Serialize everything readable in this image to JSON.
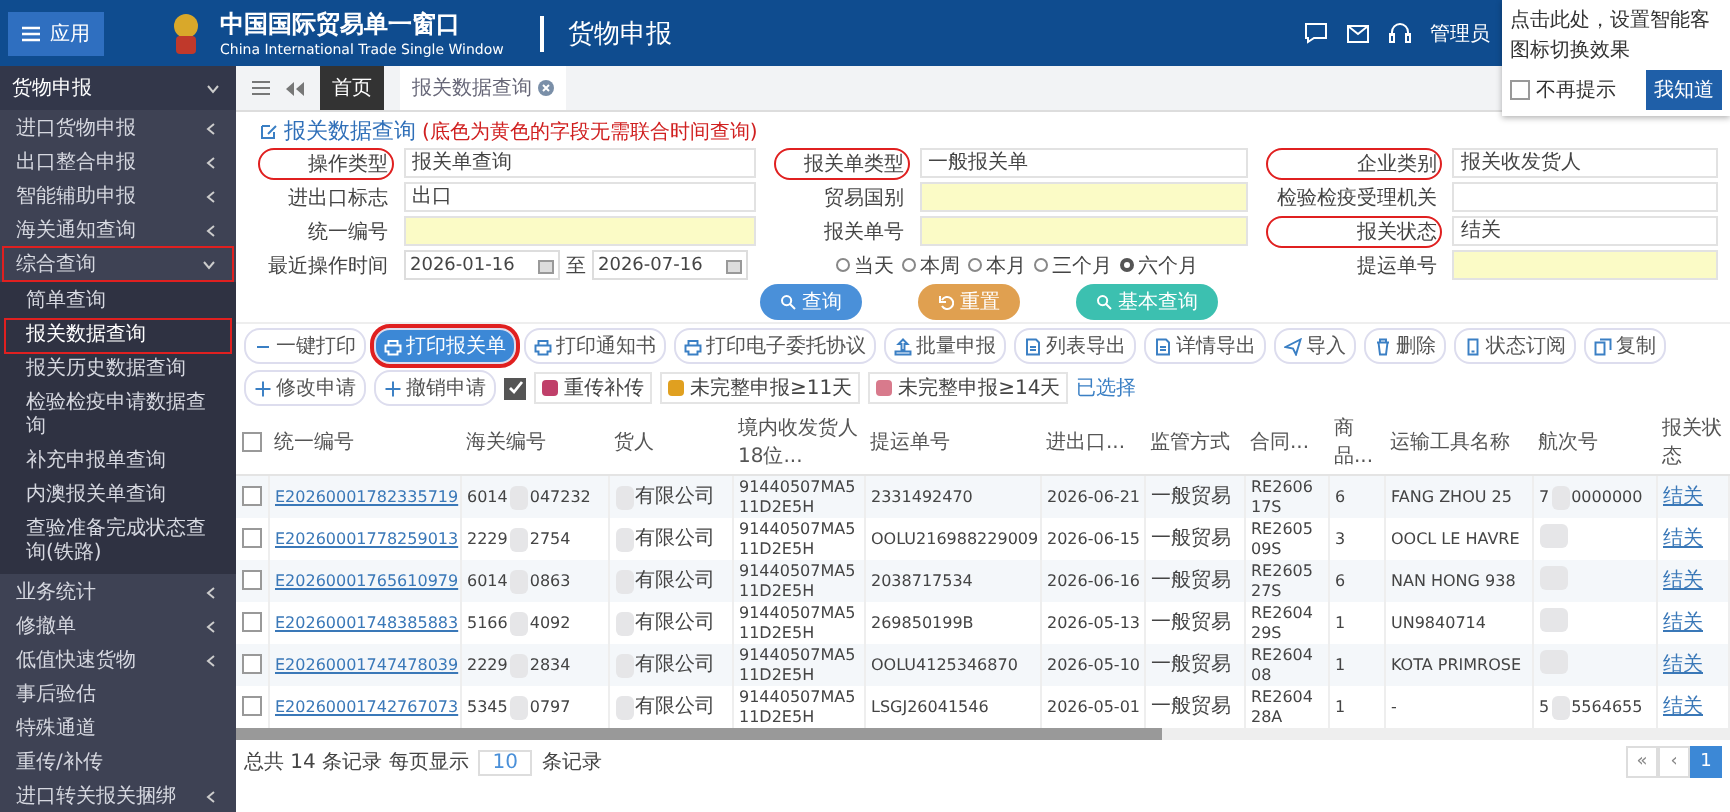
{
  "header": {
    "app_button": "应用",
    "logo_title": "中国国际贸易单一窗口",
    "logo_subtitle": "China International Trade Single Window",
    "module": "货物申报",
    "user": "管理员"
  },
  "tip": {
    "text": "点击此处，设置智能客",
    "text2": "图标切换效果",
    "dont_show": "不再提示",
    "dont_show_checked": false,
    "button": "我知道"
  },
  "sidebar": {
    "section": "货物申报",
    "items": [
      {
        "label": "进口货物申报",
        "expanded": false,
        "annotated": false
      },
      {
        "label": "出口整合申报",
        "expanded": false,
        "annotated": false
      },
      {
        "label": "智能辅助申报",
        "expanded": false,
        "annotated": false
      },
      {
        "label": "海关通知查询",
        "expanded": false,
        "annotated": false
      },
      {
        "label": "综合查询",
        "expanded": true,
        "annotated": true,
        "children": [
          {
            "label": "简单查询",
            "selected": false,
            "annotated": false
          },
          {
            "label": "报关数据查询",
            "selected": true,
            "annotated": true
          },
          {
            "label": "报关历史数据查询",
            "selected": false,
            "annotated": false
          },
          {
            "label": "检验检疫申请数据查询",
            "selected": false,
            "annotated": false
          },
          {
            "label": "补充申报单查询",
            "selected": false,
            "annotated": false
          },
          {
            "label": "内澳报关单查询",
            "selected": false,
            "annotated": false
          },
          {
            "label": "查验准备完成状态查询(铁路)",
            "selected": false,
            "annotated": false
          }
        ]
      },
      {
        "label": "业务统计",
        "expanded": false,
        "annotated": false
      },
      {
        "label": "修撤单",
        "expanded": false,
        "annotated": false
      },
      {
        "label": "低值快速货物",
        "expanded": false,
        "annotated": false
      },
      {
        "label": "事后验估",
        "annotated": false
      },
      {
        "label": "特殊通道",
        "annotated": false
      },
      {
        "label": "重传/补传",
        "annotated": false
      },
      {
        "label": "进口转关报关捆绑",
        "expanded": false,
        "annotated": false
      }
    ]
  },
  "tabs": [
    {
      "label": "首页",
      "selected": false,
      "closable": false
    },
    {
      "label": "报关数据查询",
      "selected": true,
      "closable": true
    }
  ],
  "form": {
    "title": "报关数据查询",
    "hint": "(底色为黄色的字段无需联合时间查询)",
    "cells": [
      {
        "kind": "text",
        "label": "操作类型",
        "value": "报关单查询",
        "required": false,
        "annotated": true
      },
      {
        "kind": "text",
        "label": "报关单类型",
        "value": "一般报关单",
        "required": false,
        "annotated": true
      },
      {
        "kind": "text",
        "label": "企业类别",
        "value": "报关收发货人",
        "required": false,
        "annotated": true
      },
      {
        "kind": "text",
        "label": "进出口标志",
        "value": "出口",
        "required": false,
        "annotated": false
      },
      {
        "kind": "text",
        "label": "贸易国别",
        "required": true,
        "annotated": false
      },
      {
        "kind": "text",
        "label": "检验检疫受理机关",
        "required": false,
        "annotated": false
      },
      {
        "kind": "text",
        "label": "统一编号",
        "required": true,
        "annotated": false
      },
      {
        "kind": "text",
        "label": "报关单号",
        "required": true,
        "annotated": false
      },
      {
        "kind": "text",
        "label": "报关状态",
        "value": "结关",
        "required": false,
        "annotated": true
      },
      {
        "kind": "date_range",
        "label": "最近操作时间",
        "from": "2026-01-16",
        "to_label": "至",
        "to": "2026-07-16"
      },
      {
        "kind": "radios",
        "options": [
          {
            "label": "当天",
            "selected": false
          },
          {
            "label": "本周",
            "selected": false
          },
          {
            "label": "本月",
            "selected": false
          },
          {
            "label": "三个月",
            "selected": false
          },
          {
            "label": "六个月",
            "selected": true
          }
        ]
      },
      {
        "kind": "text",
        "label": "提运单号",
        "required": true,
        "annotated": false
      }
    ],
    "buttons": [
      {
        "label": "查询",
        "kind": "search"
      },
      {
        "label": "重置",
        "kind": "reset"
      },
      {
        "label": "基本查询",
        "kind": "basic"
      }
    ]
  },
  "toolbar": {
    "buttons": [
      {
        "label": "一键打印",
        "kind": "minus",
        "selected": false,
        "annotated": false
      },
      {
        "label": "打印报关单",
        "kind": "printer",
        "selected": true,
        "annotated": true
      },
      {
        "label": "打印通知书",
        "kind": "printer",
        "selected": false,
        "annotated": false
      },
      {
        "label": "打印电子委托协议",
        "kind": "printer",
        "selected": false,
        "annotated": false
      },
      {
        "label": "批量申报",
        "kind": "upload",
        "selected": false,
        "annotated": false
      },
      {
        "label": "列表导出",
        "kind": "export",
        "selected": false,
        "annotated": false
      },
      {
        "label": "详情导出",
        "kind": "export",
        "selected": false,
        "annotated": false
      },
      {
        "label": "导入",
        "kind": "send",
        "selected": false,
        "annotated": false
      },
      {
        "label": "删除",
        "kind": "trash",
        "selected": false,
        "annotated": false
      },
      {
        "label": "状态订阅",
        "kind": "phone",
        "selected": false,
        "annotated": false
      },
      {
        "label": "复制",
        "kind": "copy",
        "selected": false,
        "annotated": false
      },
      {
        "label": "修改申请",
        "kind": "plus",
        "selected": false,
        "annotated": false
      },
      {
        "label": "撤销申请",
        "kind": "plus",
        "selected": false,
        "annotated": false
      }
    ],
    "filter_checked": true,
    "legend": [
      {
        "label": "重传补传",
        "color": "#c0406a"
      },
      {
        "label": "未完整申报≥11天",
        "color": "#e0a020"
      },
      {
        "label": "未完整申报≥14天",
        "color": "#d87a8c"
      }
    ],
    "selected_link": "已选择"
  },
  "table": {
    "all_checked": false,
    "columns": [
      "统一编号",
      "海关编号",
      "货人",
      "境内收发货人18位...",
      "提运单号",
      "进出口...",
      "监管方式",
      "合同...",
      "商品...",
      "运输工具名称",
      "航次号",
      "报关状态"
    ],
    "rows": [
      {
        "checked": false,
        "cells": [
          {
            "kind": "link",
            "text": "E20260001782335719"
          },
          {
            "kind": "partial",
            "start": "6014",
            "end": "047232"
          },
          {
            "kind": "partial",
            "end": "有限公司"
          },
          {
            "kind": "text",
            "text": "91440507MA511D2E5H"
          },
          {
            "kind": "text",
            "text": "2331492470"
          },
          {
            "kind": "text",
            "text": "2026-06-21"
          },
          {
            "kind": "text",
            "text": "一般贸易"
          },
          {
            "kind": "text",
            "text": "RE260617S"
          },
          {
            "kind": "text",
            "text": "6"
          },
          {
            "kind": "text",
            "text": "FANG ZHOU 25"
          },
          {
            "kind": "partial",
            "start": "7",
            "end": "0000000"
          },
          {
            "kind": "link",
            "text": "结关"
          }
        ]
      },
      {
        "checked": false,
        "cells": [
          {
            "kind": "link",
            "text": "E20260001778259013"
          },
          {
            "kind": "partial",
            "start": "2229",
            "end": "2754"
          },
          {
            "kind": "partial",
            "end": "有限公司"
          },
          {
            "kind": "text",
            "text": "91440507MA511D2E5H"
          },
          {
            "kind": "text",
            "text": "OOLU216988229009"
          },
          {
            "kind": "text",
            "text": "2026-06-15"
          },
          {
            "kind": "text",
            "text": "一般贸易"
          },
          {
            "kind": "text",
            "text": "RE260509S"
          },
          {
            "kind": "text",
            "text": "3"
          },
          {
            "kind": "text",
            "text": "OOCL LE HAVRE"
          },
          {
            "kind": "redacted"
          },
          {
            "kind": "link",
            "text": "结关"
          }
        ]
      },
      {
        "checked": false,
        "cells": [
          {
            "kind": "link",
            "text": "E20260001765610979"
          },
          {
            "kind": "partial",
            "start": "6014",
            "end": "0863"
          },
          {
            "kind": "partial",
            "end": "有限公司"
          },
          {
            "kind": "text",
            "text": "91440507MA511D2E5H"
          },
          {
            "kind": "text",
            "text": "2038717534"
          },
          {
            "kind": "text",
            "text": "2026-06-16"
          },
          {
            "kind": "text",
            "text": "一般贸易"
          },
          {
            "kind": "text",
            "text": "RE260527S"
          },
          {
            "kind": "text",
            "text": "6"
          },
          {
            "kind": "text",
            "text": "NAN HONG 938"
          },
          {
            "kind": "redacted"
          },
          {
            "kind": "link",
            "text": "结关"
          }
        ]
      },
      {
        "checked": false,
        "cells": [
          {
            "kind": "link",
            "text": "E20260001748385883"
          },
          {
            "kind": "partial",
            "start": "5166",
            "end": "4092"
          },
          {
            "kind": "partial",
            "end": "有限公司"
          },
          {
            "kind": "text",
            "text": "91440507MA511D2E5H"
          },
          {
            "kind": "text",
            "text": "269850199B"
          },
          {
            "kind": "text",
            "text": "2026-05-13"
          },
          {
            "kind": "text",
            "text": "一般贸易"
          },
          {
            "kind": "text",
            "text": "RE260429S"
          },
          {
            "kind": "text",
            "text": "1"
          },
          {
            "kind": "text",
            "text": "UN9840714"
          },
          {
            "kind": "redacted"
          },
          {
            "kind": "link",
            "text": "结关"
          }
        ]
      },
      {
        "checked": false,
        "cells": [
          {
            "kind": "link",
            "text": "E20260001747478039"
          },
          {
            "kind": "partial",
            "start": "2229",
            "end": "2834"
          },
          {
            "kind": "partial",
            "end": "有限公司"
          },
          {
            "kind": "text",
            "text": "91440507MA511D2E5H"
          },
          {
            "kind": "text",
            "text": "OOLU4125346870"
          },
          {
            "kind": "text",
            "text": "2026-05-10"
          },
          {
            "kind": "text",
            "text": "一般贸易"
          },
          {
            "kind": "text",
            "text": "RE260408"
          },
          {
            "kind": "text",
            "text": "1"
          },
          {
            "kind": "text",
            "text": "KOTA PRIMROSE"
          },
          {
            "kind": "redacted"
          },
          {
            "kind": "link",
            "text": "结关"
          }
        ]
      },
      {
        "checked": false,
        "cells": [
          {
            "kind": "link",
            "text": "E20260001742767073"
          },
          {
            "kind": "partial",
            "start": "5345",
            "end": "0797"
          },
          {
            "kind": "partial",
            "end": "有限公司"
          },
          {
            "kind": "text",
            "text": "91440507MA511D2E5H"
          },
          {
            "kind": "text",
            "text": "LSGJ26041546"
          },
          {
            "kind": "text",
            "text": "2026-05-01"
          },
          {
            "kind": "text",
            "text": "一般贸易"
          },
          {
            "kind": "text",
            "text": "RE260428A"
          },
          {
            "kind": "text",
            "text": "1"
          },
          {
            "kind": "text",
            "text": "-"
          },
          {
            "kind": "partial",
            "start": "5",
            "end": "5564655"
          },
          {
            "kind": "link",
            "text": "结关"
          }
        ]
      }
    ]
  },
  "footer": {
    "total": "总共 14 条记录 每页显示",
    "page_size": "10",
    "suffix": "条记录",
    "pages": [
      {
        "label": "«",
        "selected": false
      },
      {
        "label": "‹",
        "selected": false
      },
      {
        "label": "1",
        "selected": true
      }
    ]
  }
}
